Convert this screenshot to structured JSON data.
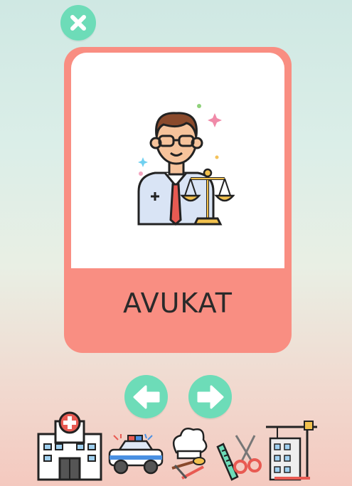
{
  "card": {
    "word": "AVUKAT",
    "image_icon": "lawyer-with-scales-icon"
  },
  "controls": {
    "close_icon": "close-icon",
    "prev_icon": "arrow-left-icon",
    "next_icon": "arrow-right-icon"
  },
  "strip_icons": [
    "hospital-icon",
    "police-car-icon",
    "chef-icon",
    "hairdresser-icon",
    "construction-icon"
  ],
  "colors": {
    "card": "#f98e82",
    "button": "#6ddcb8",
    "accent_red": "#e85a52"
  }
}
